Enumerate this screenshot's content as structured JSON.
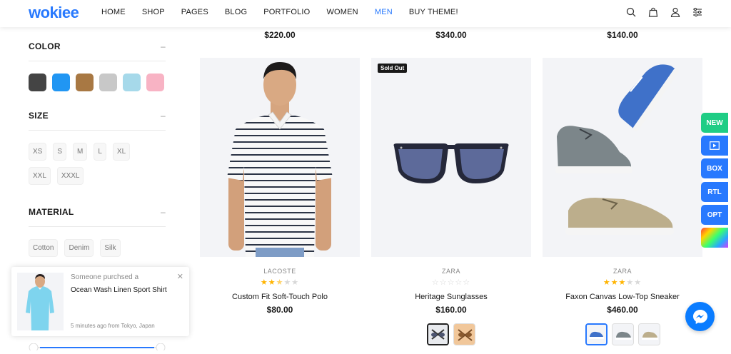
{
  "header": {
    "logo": "wokiee",
    "nav": [
      "HOME",
      "SHOP",
      "PAGES",
      "BLOG",
      "PORTFOLIO",
      "WOMEN",
      "MEN",
      "BUY THEME!"
    ],
    "active_nav": "MEN",
    "icons": [
      "search-icon",
      "bag-icon",
      "user-icon",
      "settings-icon"
    ]
  },
  "filters": {
    "color": {
      "title": "COLOR",
      "toggle": "–",
      "swatches": [
        "#444444",
        "#2196f3",
        "#a87843",
        "#c8c8c8",
        "#a6d9ea",
        "#f8b3c4"
      ]
    },
    "size": {
      "title": "SIZE",
      "toggle": "–",
      "options": [
        "XS",
        "S",
        "M",
        "L",
        "XL",
        "XXL",
        "XXXL"
      ]
    },
    "material": {
      "title": "MATERIAL",
      "toggle": "–",
      "options": [
        "Cotton",
        "Denim",
        "Silk"
      ]
    }
  },
  "top_prices": [
    "$220.00",
    "$340.00",
    "$140.00"
  ],
  "products": [
    {
      "brand": "LACOSTE",
      "rating": 2.5,
      "name": "Custom Fit Soft-Touch Polo",
      "price": "$80.00",
      "badge": ""
    },
    {
      "brand": "ZARA",
      "rating": 0,
      "name": "Heritage Sunglasses",
      "price": "$160.00",
      "badge": "Sold Out"
    },
    {
      "brand": "ZARA",
      "rating": 3,
      "name": "Faxon Canvas Low-Top Sneaker",
      "price": "$460.00",
      "badge": ""
    }
  ],
  "side_buttons": [
    {
      "label": "NEW",
      "color": "#1fcd85"
    },
    {
      "label": "",
      "color": "#2879fe"
    },
    {
      "label": "BOX",
      "color": "#2879fe"
    },
    {
      "label": "RTL",
      "color": "#2879fe"
    },
    {
      "label": "OPT",
      "color": "#2879fe"
    }
  ],
  "toast": {
    "line1": "Someone purchsed a",
    "product": "Ocean Wash Linen Sport Shirt",
    "meta": "5 minutes ago from Tokyo, Japan",
    "close": "✕"
  },
  "colors": {
    "accent": "#2879fe",
    "star": "#ffb400"
  }
}
